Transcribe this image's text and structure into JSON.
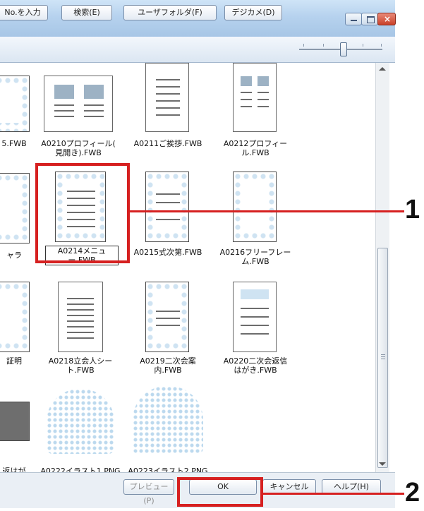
{
  "toolbar": {
    "no_input_label": "No.を入力",
    "search_label": "検索(E)",
    "user_folder_label": "ユーザフォルダ(F)",
    "digicam_label": "デジカメ(D)"
  },
  "items": [
    {
      "label": "5.FWB"
    },
    {
      "label": "A0210プロフィール(\n見開き).FWB"
    },
    {
      "label": "A0211ご挨拶.FWB"
    },
    {
      "label": "A0212プロフィー\nル.FWB"
    },
    {
      "label": "ャラ"
    },
    {
      "label": "A0214メニュー.FWB"
    },
    {
      "label": "A0215式次第.FWB"
    },
    {
      "label": "A0216フリーフレー\nム.FWB"
    },
    {
      "label": "証明"
    },
    {
      "label": "A0218立会人シー\nト.FWB"
    },
    {
      "label": "A0219二次会案\n内.FWB"
    },
    {
      "label": "A0220二次会返信\nはがき.FWB"
    },
    {
      "label": "返はが"
    },
    {
      "label": "A0222イラスト1.PNG"
    },
    {
      "label": "A0223イラスト2.PNG"
    }
  ],
  "buttons": {
    "preview": "プレビュー(P)",
    "ok": "OK",
    "cancel": "キャンセル",
    "help": "ヘルプ(H)"
  },
  "callouts": {
    "one": "1",
    "two": "2"
  },
  "colors": {
    "highlight": "#d62020",
    "lace": "#cfe3f2"
  }
}
